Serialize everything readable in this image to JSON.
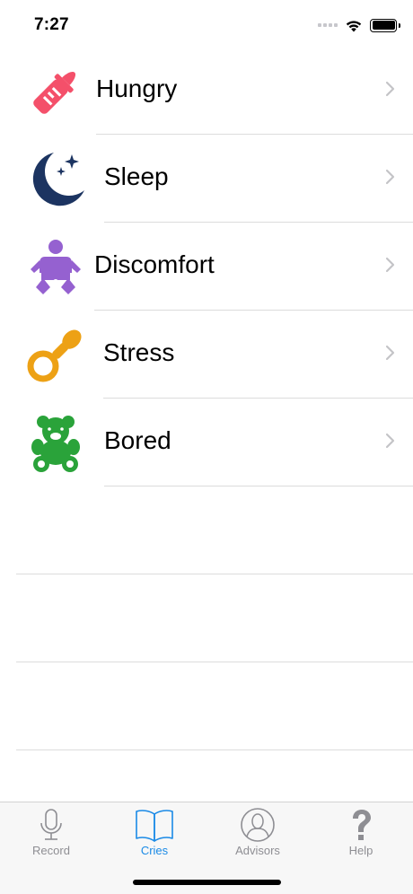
{
  "status_bar": {
    "time": "7:27"
  },
  "cries": [
    {
      "label": "Hungry",
      "icon": "baby-bottle-icon",
      "color": "#f4506a"
    },
    {
      "label": "Sleep",
      "icon": "moon-stars-icon",
      "color": "#1c3461"
    },
    {
      "label": "Discomfort",
      "icon": "baby-icon",
      "color": "#9561d0"
    },
    {
      "label": "Stress",
      "icon": "pacifier-icon",
      "color": "#eda115"
    },
    {
      "label": "Bored",
      "icon": "teddy-bear-icon",
      "color": "#2aa33a"
    }
  ],
  "tabs": [
    {
      "label": "Record",
      "icon": "microphone-icon",
      "active": false
    },
    {
      "label": "Cries",
      "icon": "open-book-icon",
      "active": true
    },
    {
      "label": "Advisors",
      "icon": "person-icon",
      "active": false
    },
    {
      "label": "Help",
      "icon": "question-mark-icon",
      "active": false
    }
  ],
  "colors": {
    "accent": "#1a8ae6",
    "tab_inactive": "#8e8e93",
    "separator": "#dcdcdc"
  }
}
